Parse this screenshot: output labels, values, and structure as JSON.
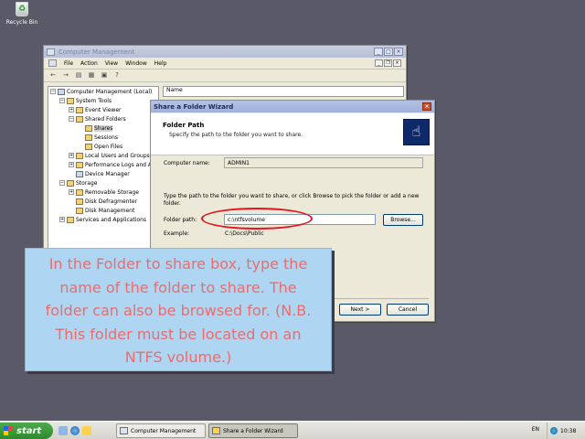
{
  "desktop": {
    "recycle_bin_label": "Recycle Bin"
  },
  "computer_management": {
    "title": "Computer Management",
    "menu": [
      "File",
      "Action",
      "View",
      "Window",
      "Help"
    ],
    "tree": [
      {
        "label": "Computer Management (Local)",
        "indent": 0,
        "expander": "minus",
        "icon": "pc"
      },
      {
        "label": "System Tools",
        "indent": 1,
        "expander": "minus",
        "icon": "folder"
      },
      {
        "label": "Event Viewer",
        "indent": 2,
        "expander": "plus",
        "icon": "folder"
      },
      {
        "label": "Shared Folders",
        "indent": 2,
        "expander": "minus",
        "icon": "folder"
      },
      {
        "label": "Shares",
        "indent": 3,
        "expander": "none",
        "icon": "folder",
        "selected": true
      },
      {
        "label": "Sessions",
        "indent": 3,
        "expander": "none",
        "icon": "folder"
      },
      {
        "label": "Open Files",
        "indent": 3,
        "expander": "none",
        "icon": "folder"
      },
      {
        "label": "Local Users and Groups",
        "indent": 2,
        "expander": "plus",
        "icon": "folder"
      },
      {
        "label": "Performance Logs and Al",
        "indent": 2,
        "expander": "plus",
        "icon": "folder"
      },
      {
        "label": "Device Manager",
        "indent": 2,
        "expander": "none",
        "icon": "pc"
      },
      {
        "label": "Storage",
        "indent": 1,
        "expander": "minus",
        "icon": "folder"
      },
      {
        "label": "Removable Storage",
        "indent": 2,
        "expander": "plus",
        "icon": "folder"
      },
      {
        "label": "Disk Defragmenter",
        "indent": 2,
        "expander": "none",
        "icon": "folder"
      },
      {
        "label": "Disk Management",
        "indent": 2,
        "expander": "none",
        "icon": "folder"
      },
      {
        "label": "Services and Applications",
        "indent": 1,
        "expander": "plus",
        "icon": "folder"
      }
    ],
    "right_header": "Name"
  },
  "wizard": {
    "title": "Share a Folder Wizard",
    "header_title": "Folder Path",
    "header_subtitle": "Specify the path to the folder you want to share.",
    "computer_name_label": "Computer name:",
    "computer_name_value": "ADMIN1",
    "instructions": "Type the path to the folder you want to share, or click Browse to pick the folder or add a new folder.",
    "folder_path_label": "Folder path:",
    "folder_path_value": "c:\\ntfsvolume",
    "browse_label": "Browse...",
    "example_label": "Example:",
    "example_value": "C:\\Docs\\Public",
    "next_label": "Next >",
    "cancel_label": "Cancel",
    "highlight_color": "#e4141e"
  },
  "callout": {
    "text": "In the Folder to share box, type the name of the folder to share. The folder can also be browsed for. (N.B. This folder must be located on an NTFS volume.)",
    "text_color": "#ef6b6b",
    "background": "#aed6f2"
  },
  "taskbar": {
    "start_label": "start",
    "tasks": [
      {
        "label": "Computer Management",
        "active": false
      },
      {
        "label": "Share a Folder Wizard",
        "active": true
      }
    ],
    "language": "EN",
    "clock": "10:38"
  }
}
